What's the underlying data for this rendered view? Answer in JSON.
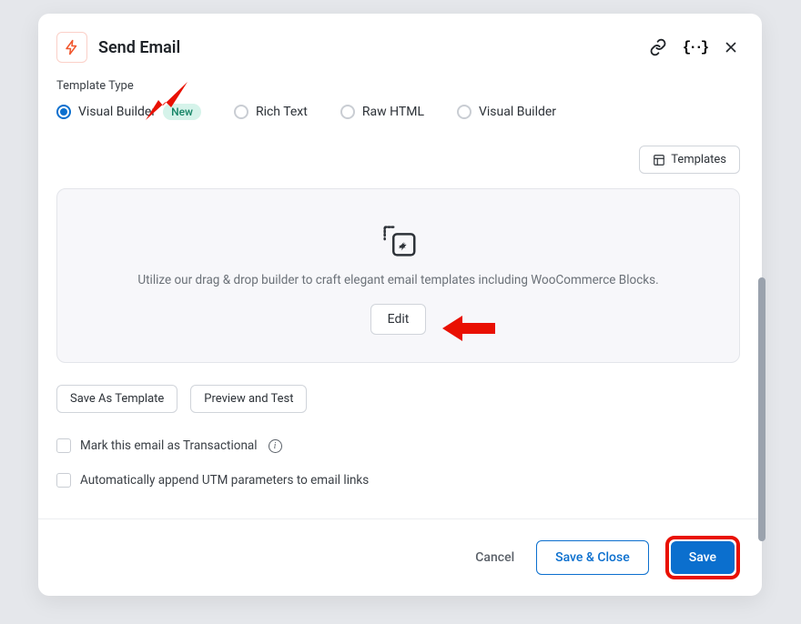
{
  "header": {
    "title": "Send Email"
  },
  "templateType": {
    "label": "Template Type",
    "options": [
      {
        "label": "Visual Builder",
        "selected": true,
        "badge": "New"
      },
      {
        "label": "Rich Text",
        "selected": false
      },
      {
        "label": "Raw HTML",
        "selected": false
      },
      {
        "label": "Visual Builder",
        "selected": false
      }
    ]
  },
  "templates_button": "Templates",
  "builder": {
    "description": "Utilize our drag & drop builder to craft elegant email templates including WooCommerce Blocks.",
    "edit_label": "Edit"
  },
  "actions": {
    "save_as_template": "Save As Template",
    "preview_test": "Preview and Test"
  },
  "options": {
    "transactional": "Mark this email as Transactional",
    "utm": "Automatically append UTM parameters to email links"
  },
  "footer": {
    "cancel": "Cancel",
    "save_close": "Save & Close",
    "save": "Save"
  }
}
